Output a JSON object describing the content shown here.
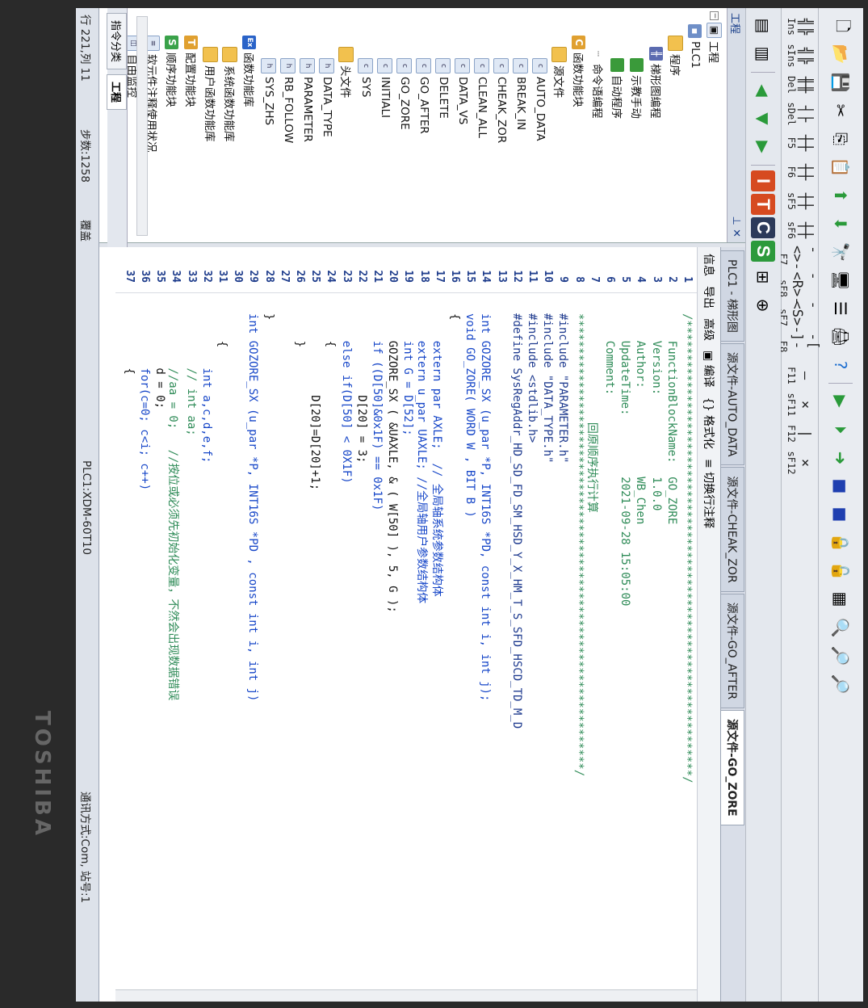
{
  "toolbar_keys": [
    {
      "glyph": "╣╠",
      "label": "Ins"
    },
    {
      "glyph": "╣╠",
      "label": "sIns"
    },
    {
      "glyph": "╫╫",
      "label": "Del"
    },
    {
      "glyph": "┤├",
      "label": "sDel"
    },
    {
      "glyph": "┼┼",
      "label": "F5"
    },
    {
      "glyph": "┼┼",
      "label": "F6"
    },
    {
      "glyph": "┼┼",
      "label": "sF5"
    },
    {
      "glyph": "┼┼",
      "label": "sF6"
    },
    {
      "glyph": "-<>-",
      "label": "F7"
    },
    {
      "glyph": "-<R>-",
      "label": "sF8"
    },
    {
      "glyph": "-<S>-",
      "label": "sF7"
    },
    {
      "glyph": "-[ ]-",
      "label": "F8"
    },
    {
      "glyph": "—",
      "label": "F11"
    },
    {
      "glyph": "×",
      "label": "sF11"
    },
    {
      "glyph": "|",
      "label": "F12"
    },
    {
      "glyph": "×",
      "label": "sF12"
    }
  ],
  "sidebar": {
    "title": "工程",
    "nodes": [
      {
        "label": "工程"
      },
      {
        "label": "PLC1"
      },
      {
        "label": "程序"
      },
      {
        "label": "梯形图编程"
      },
      {
        "label": "示教手动"
      },
      {
        "label": "自动程序"
      },
      {
        "label": "命令语编程"
      },
      {
        "label": "函数功能块"
      },
      {
        "label": "源文件"
      },
      {
        "label": "AUTO_DATA"
      },
      {
        "label": "BREAK_IN"
      },
      {
        "label": "CHEAK_ZOR"
      },
      {
        "label": "CLEAN_ALL"
      },
      {
        "label": "DATA_VS"
      },
      {
        "label": "DELETE"
      },
      {
        "label": "GO_AFTER"
      },
      {
        "label": "GO_ZORE"
      },
      {
        "label": "INITIALI"
      },
      {
        "label": "SYS"
      },
      {
        "label": "头文件"
      },
      {
        "label": "DATA_TYPE"
      },
      {
        "label": "PARAMETER"
      },
      {
        "label": "RB_FOLLOW"
      },
      {
        "label": "SYS_ZHS"
      },
      {
        "label": "函数功能库"
      },
      {
        "label": "系统函数功能库"
      },
      {
        "label": "用户函数功能库"
      },
      {
        "label": "配置功能块"
      },
      {
        "label": "顺序功能块"
      },
      {
        "label": "软元件注释使用状况"
      },
      {
        "label": "自由监控"
      }
    ],
    "bottom_tabs": [
      "指令分类",
      "工程"
    ]
  },
  "tabs": [
    "PLC1 - 梯形图",
    "源文件-AUTO_DATA",
    "源文件-CHEAK_ZOR",
    "源文件-GO_AFTER",
    "源文件-GO_ZORE"
  ],
  "editor_toolbar": [
    "信息",
    "导出",
    "高级",
    "编译",
    "格式化",
    "切换行注释"
  ],
  "code_lines": [
    {
      "n": "1",
      "t": "/*******************************************************************/",
      "c": "c-cmt"
    },
    {
      "n": "2",
      "t": "    FunctionBlockName:  GO_ZORE",
      "c": "c-cmt"
    },
    {
      "n": "3",
      "t": "    Version:            1.0.0",
      "c": "c-cmt"
    },
    {
      "n": "4",
      "t": "    Author:             WB_Chen",
      "c": "c-cmt"
    },
    {
      "n": "5",
      "t": "    UpdateTime:         2021-09-28 15:05:00",
      "c": "c-cmt"
    },
    {
      "n": "6",
      "t": "    Comment:",
      "c": "c-cmt"
    },
    {
      "n": "7",
      "t": "                回原顺序执行计算",
      "c": "c-cmt"
    },
    {
      "n": "8",
      "t": "*******************************************************************/",
      "c": "c-cmt"
    },
    {
      "n": "9",
      "t": "#include \"PARAMETER.h\"",
      "c": "c-pre"
    },
    {
      "n": "10",
      "t": "#include \"DATA_TYPE.h\"",
      "c": "c-pre"
    },
    {
      "n": "11",
      "t": "#include <stdlib.h>",
      "c": "c-pre"
    },
    {
      "n": "12",
      "t": "#define SysRegAddr_HD_SD_FD_SM_HSD_Y_X_HM_T_S_SFD_HSCD_TD_M_D",
      "c": "c-pre"
    },
    {
      "n": "13",
      "t": "",
      "c": ""
    },
    {
      "n": "14",
      "t": "int GOZORE_SX (u_par *P, INT16S *PD, const int i, int j);",
      "c": "c-kw"
    },
    {
      "n": "15",
      "t": "void GO_ZORE( WORD W , BIT B )",
      "c": "c-kw"
    },
    {
      "n": "16",
      "t": "{",
      "c": ""
    },
    {
      "n": "17",
      "t": "    extern par AXLE;  // 全局轴系统参数结构体",
      "c": "c-kw"
    },
    {
      "n": "18",
      "t": "    extern u_par UAXLE; //全局轴用户参数结构体",
      "c": "c-kw"
    },
    {
      "n": "19",
      "t": "    int G = D[52];",
      "c": "c-kw"
    },
    {
      "n": "20",
      "t": "    GOZORE_SX ( &UAXLE, & ( W[50] ), 5, G );",
      "c": ""
    },
    {
      "n": "21",
      "t": "    if ((D[50]&0x1F) == 0x1F)",
      "c": "c-kw"
    },
    {
      "n": "22",
      "t": "            D[20] = 3;",
      "c": ""
    },
    {
      "n": "23",
      "t": "    else if(D[50] < 0X1F)",
      "c": "c-kw"
    },
    {
      "n": "24",
      "t": "    {",
      "c": ""
    },
    {
      "n": "25",
      "t": "            D[20]=D[20]+1;",
      "c": ""
    },
    {
      "n": "26",
      "t": "    }",
      "c": ""
    },
    {
      "n": "27",
      "t": "",
      "c": ""
    },
    {
      "n": "28",
      "t": "}",
      "c": ""
    },
    {
      "n": "29",
      "t": "int GOZORE_SX (u_par *P, INT16S *PD , const int i, int j)",
      "c": "c-kw"
    },
    {
      "n": "30",
      "t": "",
      "c": ""
    },
    {
      "n": "31",
      "t": "    {",
      "c": ""
    },
    {
      "n": "32",
      "t": "        int a,c,d,e,f;",
      "c": "c-kw"
    },
    {
      "n": "33",
      "t": "        // int aa;",
      "c": "c-cmt"
    },
    {
      "n": "34",
      "t": "        //aa = 0;   //按位或必须先初始化变量，不然会出现数据错误",
      "c": "c-cmt"
    },
    {
      "n": "35",
      "t": "        d = 0;",
      "c": ""
    },
    {
      "n": "36",
      "t": "        for(c=0; c<i; c++)",
      "c": "c-kw"
    },
    {
      "n": "37",
      "t": "        {",
      "c": ""
    }
  ],
  "statusbar": {
    "position": "行 221,列 11",
    "steps": "步数:1258",
    "mode": "覆盖",
    "device": "PLC1:XDM-60T10",
    "comm": "通讯方式:Com, 站号:1"
  },
  "brand": "TOSHIBA",
  "colors": {
    "comment": "#2e8b57",
    "keyword": "#1646c8",
    "linenum": "#1f3d8c",
    "tab_active": "#ffffff"
  }
}
